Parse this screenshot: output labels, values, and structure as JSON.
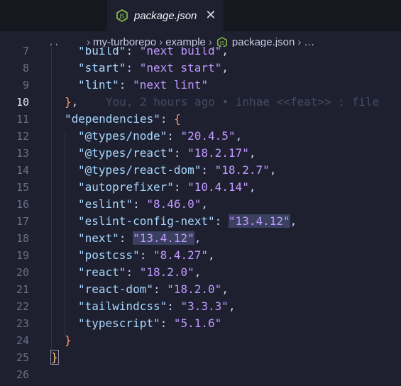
{
  "tab": {
    "label": "package.json",
    "close": "✕"
  },
  "breadcrumbs": {
    "prefix": ", ,",
    "items": [
      "my-turborepo",
      "example",
      "package.json",
      "…"
    ]
  },
  "editor": {
    "active_line": 10,
    "blame": "You, 2 hours ago • inhae <<feat>> : file",
    "lines": [
      {
        "n": "7",
        "indent": "  ",
        "key": "\"build\"",
        "val": "\"next build\"",
        "tail": ","
      },
      {
        "n": "8",
        "indent": "  ",
        "key": "\"start\"",
        "val": "\"next start\"",
        "tail": ","
      },
      {
        "n": "9",
        "indent": "  ",
        "key": "\"lint\"",
        "val": "\"next lint\"",
        "tail": ""
      },
      {
        "n": "10",
        "text": "},",
        "blame": true
      },
      {
        "n": "11",
        "key": "\"dependencies\"",
        "text": ": {"
      },
      {
        "n": "12",
        "indent": "  ",
        "key": "\"@types/node\"",
        "val": "\"20.4.5\"",
        "tail": ","
      },
      {
        "n": "13",
        "indent": "  ",
        "key": "\"@types/react\"",
        "val": "\"18.2.17\"",
        "tail": ","
      },
      {
        "n": "14",
        "indent": "  ",
        "key": "\"@types/react-dom\"",
        "val": "\"18.2.7\"",
        "tail": ","
      },
      {
        "n": "15",
        "indent": "  ",
        "key": "\"autoprefixer\"",
        "val": "\"10.4.14\"",
        "tail": ","
      },
      {
        "n": "16",
        "indent": "  ",
        "key": "\"eslint\"",
        "val": "\"8.46.0\"",
        "tail": ","
      },
      {
        "n": "17",
        "indent": "  ",
        "key": "\"eslint-config-next\"",
        "val": "\"13.4.12\"",
        "tail": ",",
        "hl": true
      },
      {
        "n": "18",
        "indent": "  ",
        "key": "\"next\"",
        "val": "\"13.4.12\"",
        "tail": ",",
        "hl": true
      },
      {
        "n": "19",
        "indent": "  ",
        "key": "\"postcss\"",
        "val": "\"8.4.27\"",
        "tail": ","
      },
      {
        "n": "20",
        "indent": "  ",
        "key": "\"react\"",
        "val": "\"18.2.0\"",
        "tail": ","
      },
      {
        "n": "21",
        "indent": "  ",
        "key": "\"react-dom\"",
        "val": "\"18.2.0\"",
        "tail": ","
      },
      {
        "n": "22",
        "indent": "  ",
        "key": "\"tailwindcss\"",
        "val": "\"3.3.3\"",
        "tail": ","
      },
      {
        "n": "23",
        "indent": "  ",
        "key": "\"typescript\"",
        "val": "\"5.1.6\"",
        "tail": ""
      },
      {
        "n": "24",
        "text": "}"
      },
      {
        "n": "25",
        "text": "}"
      },
      {
        "n": "26",
        "text": ""
      }
    ]
  },
  "colors": {
    "background": "#1e2030",
    "key": "#c3e88d",
    "string": "#c099ff",
    "brace": "#ff966c",
    "node_icon": "#8bc34a"
  }
}
